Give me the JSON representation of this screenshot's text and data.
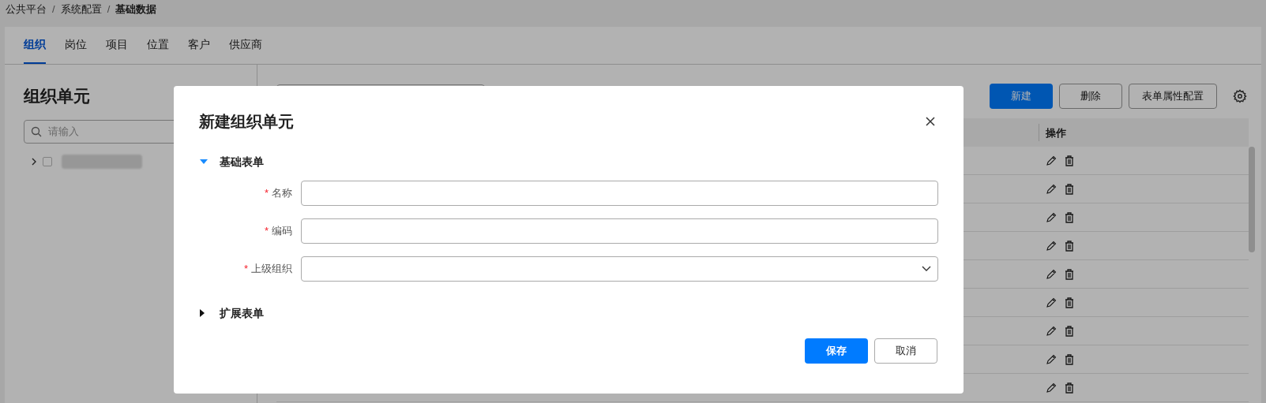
{
  "breadcrumb": [
    {
      "label": "公共平台",
      "current": false
    },
    {
      "separator": "/",
      "label": "系统配置",
      "current": false
    },
    {
      "separator": "/",
      "label": "基础数据",
      "current": true
    }
  ],
  "tabs": [
    {
      "label": "组织",
      "selected": true
    },
    {
      "label": "岗位",
      "selected": false
    },
    {
      "label": "项目",
      "selected": false
    },
    {
      "label": "位置",
      "selected": false
    },
    {
      "label": "客户",
      "selected": false
    },
    {
      "label": "供应商",
      "selected": false
    }
  ],
  "sidebar": {
    "title": "组织单元",
    "search": {
      "placeholder": "请输入"
    },
    "tree": [
      {
        "checked": false,
        "expanded": false
      }
    ]
  },
  "toolbar": {
    "buttons": [
      {
        "label": "新建",
        "kind": "primary"
      },
      {
        "label": "删除",
        "kind": "default"
      },
      {
        "label": "表单属性配置",
        "kind": "default"
      }
    ]
  },
  "table": {
    "columns": [
      {
        "label": "操作"
      }
    ]
  },
  "dialog": {
    "title": "新建组织单元",
    "sections": [
      {
        "title": "基础表单",
        "expanded": true,
        "fields": [
          {
            "label": "名称",
            "required_mark": "*",
            "kind": "text"
          },
          {
            "label": "编码",
            "required_mark": "*",
            "kind": "text"
          },
          {
            "label": "上级组织",
            "required_mark": "*",
            "kind": "select"
          }
        ]
      },
      {
        "title": "扩展表单",
        "expanded": false
      }
    ],
    "buttons": [
      {
        "label": "保存",
        "kind": "primary"
      },
      {
        "label": "取消",
        "kind": "default"
      }
    ]
  }
}
